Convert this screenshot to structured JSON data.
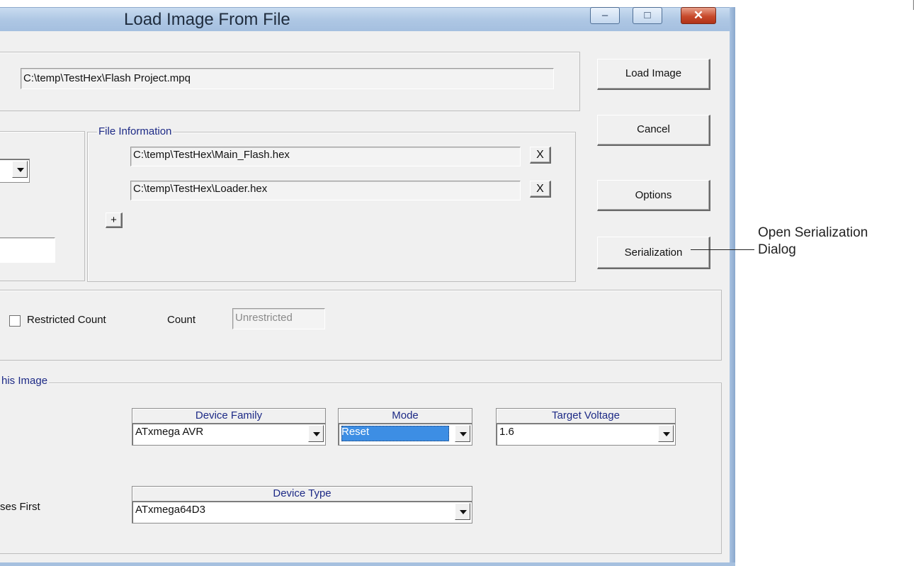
{
  "window": {
    "title": "Load Image From File",
    "minimize": "–",
    "restore": "□",
    "close": "✕"
  },
  "project_file": {
    "value": "C:\\temp\\TestHex\\Flash Project.mpq"
  },
  "buttons": {
    "load_image": "Load Image",
    "cancel": "Cancel",
    "options": "Options",
    "serialization": "Serialization"
  },
  "file_information": {
    "legend": "File Information",
    "files": [
      {
        "path": "C:\\temp\\TestHex\\Main_Flash.hex",
        "remove": "X"
      },
      {
        "path": "C:\\temp\\TestHex\\Loader.hex",
        "remove": "X"
      }
    ],
    "add": "+"
  },
  "count_section": {
    "restricted_count_label": "Restricted Count",
    "count_label": "Count",
    "count_value": "Unrestricted",
    "restricted_checked": false
  },
  "image_section": {
    "legend": "his Image",
    "device_family": {
      "header": "Device Family",
      "value": "ATxmega AVR"
    },
    "mode": {
      "header": "Mode",
      "value": "Reset"
    },
    "target_voltage": {
      "header": "Target Voltage",
      "value": "1.6"
    },
    "device_type": {
      "header": "Device Type",
      "value": "ATxmega64D3"
    },
    "partial_label": "ses First"
  },
  "annotation": {
    "line1": "Open Serialization",
    "line2": "Dialog"
  },
  "colors": {
    "accent_text": "#1d2a86",
    "selection": "#3d8ee4",
    "titlebar": "#aec7e4"
  }
}
